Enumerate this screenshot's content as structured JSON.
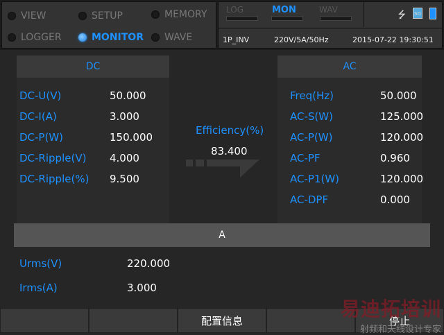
{
  "modes": [
    {
      "label": "VIEW",
      "active": false
    },
    {
      "label": "SETUP",
      "active": false
    },
    {
      "label": "MEMORY",
      "active": false
    },
    {
      "label": "LOGGER",
      "active": false
    },
    {
      "label": "MONITOR",
      "active": true
    },
    {
      "label": "WAVE",
      "active": false
    }
  ],
  "tabs": [
    {
      "label": "LOG"
    },
    {
      "label": "MON",
      "active": true
    },
    {
      "label": "WAV"
    }
  ],
  "icons": [
    "usb-icon",
    "sd-card-icon",
    "battery-icon"
  ],
  "info": {
    "config": "1P_INV",
    "range": "220V/5A/50Hz",
    "datetime": "2015-07-22 19:30:51"
  },
  "dc": {
    "title": "DC",
    "rows": [
      {
        "label": "DC-U(V)",
        "value": "50.000"
      },
      {
        "label": "DC-I(A)",
        "value": "3.000"
      },
      {
        "label": "DC-P(W)",
        "value": "150.000"
      },
      {
        "label": "DC-Ripple(V)",
        "value": "4.000"
      },
      {
        "label": "DC-Ripple(%)",
        "value": "9.500"
      }
    ]
  },
  "efficiency": {
    "label": "Efficiency(%)",
    "value": "83.400"
  },
  "ac": {
    "title": "AC",
    "rows": [
      {
        "label": "Freq(Hz)",
        "value": "50.000"
      },
      {
        "label": "AC-S(W)",
        "value": "125.000"
      },
      {
        "label": "AC-P(W)",
        "value": "120.000"
      },
      {
        "label": "AC-PF",
        "value": "0.960"
      },
      {
        "label": "AC-P1(W)",
        "value": "120.000"
      },
      {
        "label": "AC-DPF",
        "value": "0.000"
      }
    ]
  },
  "phase": {
    "title": "A",
    "rows": [
      {
        "label": "Urms(V)",
        "value": "220.000"
      },
      {
        "label": "Irms(A)",
        "value": "3.000"
      }
    ]
  },
  "buttons": [
    "",
    "",
    "配置信息",
    "",
    "停止"
  ],
  "watermark": {
    "line1": "易迪拓培训",
    "line2": "射频和天线设计专家"
  },
  "colors": {
    "accent": "#1e90ff"
  }
}
